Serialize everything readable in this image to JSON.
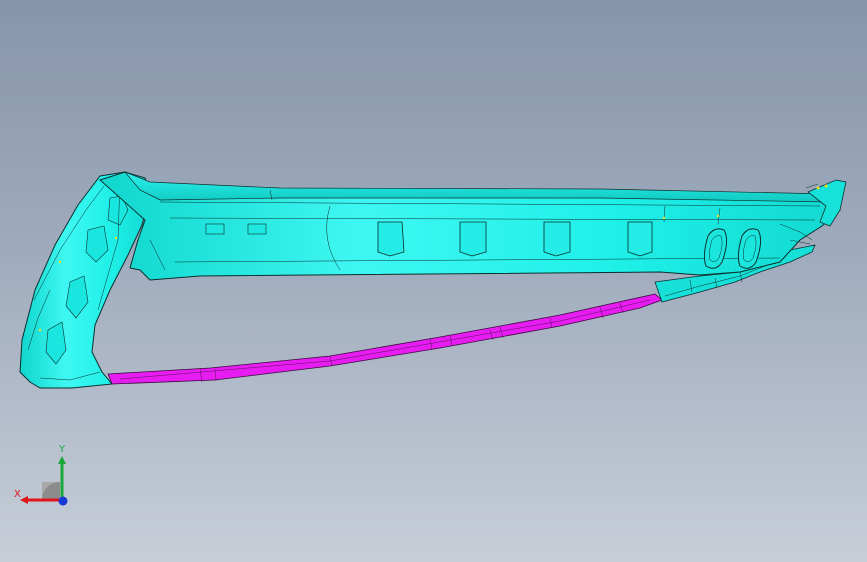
{
  "viewport": {
    "background_top": "#8795aa",
    "background_bottom": "#c7ced8"
  },
  "model": {
    "body_color": "#19f0e6",
    "body_shade": "#0fc8c2",
    "edge_color": "#0b2f2e",
    "trim_color": "#e61cf0"
  },
  "triad": {
    "x_label": "X",
    "y_label": "Y",
    "x_color": "#e0161c",
    "y_color": "#1aa83a",
    "z_color": "#1638d6"
  }
}
